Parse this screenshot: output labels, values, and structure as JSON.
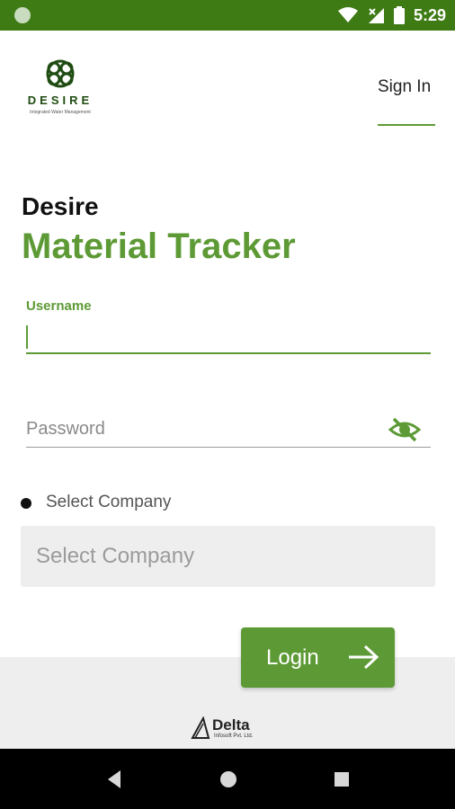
{
  "status_bar": {
    "time": "5:29",
    "icons": [
      "circle-indicator-icon",
      "wifi-icon",
      "signal-icon",
      "battery-icon"
    ]
  },
  "header": {
    "logo_text": "DESIRE",
    "logo_tagline": "Integrated Water Management",
    "tab_label": "Sign In"
  },
  "title": {
    "brand": "Desire",
    "app_name": "Material Tracker"
  },
  "form": {
    "username_label": "Username",
    "username_value": "",
    "password_placeholder": "Password",
    "company_label": "Select Company",
    "company_select_placeholder": "Select Company",
    "login_label": "Login"
  },
  "footer": {
    "vendor_name": "Delta",
    "vendor_sub": "Infosoft Pvt. Ltd."
  },
  "colors": {
    "accent": "#5d9a35",
    "status_bar": "#3e7b14",
    "field_bg": "#eeeeee"
  }
}
